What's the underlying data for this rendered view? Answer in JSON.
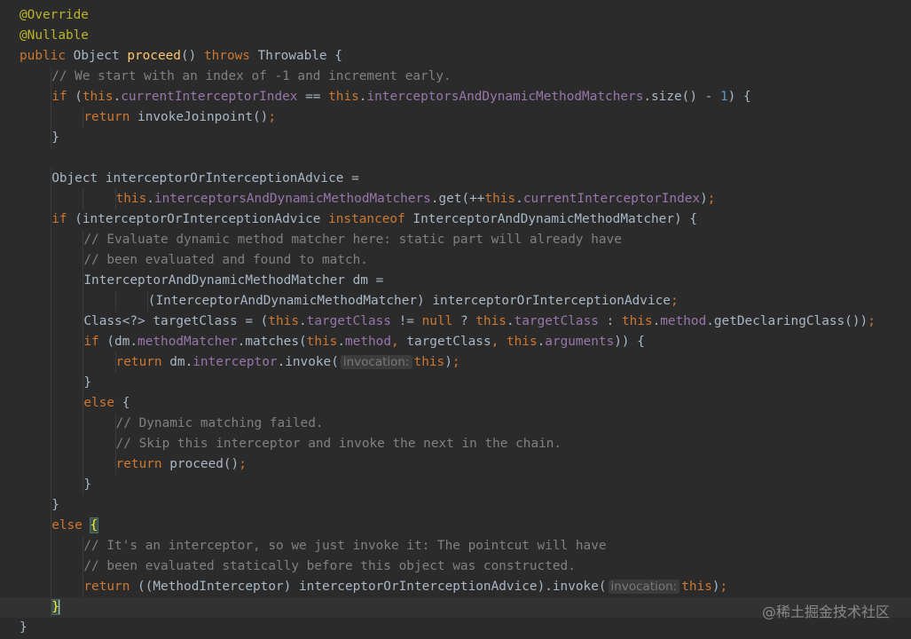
{
  "editor": {
    "theme_colors": {
      "background": "#2b2b2b",
      "keyword": "#cc7832",
      "annotation": "#bbb529",
      "comment": "#808080",
      "field": "#9876aa",
      "method_declaration": "#ffc66d",
      "number": "#6897bb",
      "plain": "#a9b7c6",
      "brace_match": "#ffef28"
    },
    "lines": [
      {
        "indent": 0,
        "tokens": [
          {
            "t": "@Override",
            "c": "ann"
          }
        ]
      },
      {
        "indent": 0,
        "tokens": [
          {
            "t": "@Nullable",
            "c": "ann"
          }
        ]
      },
      {
        "indent": 0,
        "tokens": [
          {
            "t": "public ",
            "c": "kw"
          },
          {
            "t": "Object ",
            "c": "pl"
          },
          {
            "t": "proceed",
            "c": "fn"
          },
          {
            "t": "() ",
            "c": "pl"
          },
          {
            "t": "throws ",
            "c": "kw"
          },
          {
            "t": "Throwable {",
            "c": "pl"
          }
        ]
      },
      {
        "indent": 1,
        "tokens": [
          {
            "t": "// We start with an index of -1 and increment early.",
            "c": "cm"
          }
        ]
      },
      {
        "indent": 1,
        "tokens": [
          {
            "t": "if ",
            "c": "kw"
          },
          {
            "t": "(",
            "c": "pl"
          },
          {
            "t": "this",
            "c": "kw"
          },
          {
            "t": ".",
            "c": "pl"
          },
          {
            "t": "currentInterceptorIndex",
            "c": "fld"
          },
          {
            "t": " == ",
            "c": "pl"
          },
          {
            "t": "this",
            "c": "kw"
          },
          {
            "t": ".",
            "c": "pl"
          },
          {
            "t": "interceptorsAndDynamicMethodMatchers",
            "c": "fld"
          },
          {
            "t": ".size() - ",
            "c": "pl"
          },
          {
            "t": "1",
            "c": "num"
          },
          {
            "t": ") {",
            "c": "pl"
          }
        ]
      },
      {
        "indent": 2,
        "tokens": [
          {
            "t": "return ",
            "c": "kw"
          },
          {
            "t": "invokeJoinpoint()",
            "c": "pl"
          },
          {
            "t": ";",
            "c": "kw"
          }
        ]
      },
      {
        "indent": 1,
        "tokens": [
          {
            "t": "}",
            "c": "pl"
          }
        ]
      },
      {
        "indent": 0,
        "tokens": []
      },
      {
        "indent": 1,
        "tokens": [
          {
            "t": "Object interceptorOrInterceptionAdvice =",
            "c": "pl"
          }
        ]
      },
      {
        "indent": 3,
        "tokens": [
          {
            "t": "this",
            "c": "kw"
          },
          {
            "t": ".",
            "c": "pl"
          },
          {
            "t": "interceptorsAndDynamicMethodMatchers",
            "c": "fld"
          },
          {
            "t": ".get(++",
            "c": "pl"
          },
          {
            "t": "this",
            "c": "kw"
          },
          {
            "t": ".",
            "c": "pl"
          },
          {
            "t": "currentInterceptorIndex",
            "c": "fld"
          },
          {
            "t": ")",
            "c": "pl"
          },
          {
            "t": ";",
            "c": "kw"
          }
        ]
      },
      {
        "indent": 1,
        "tokens": [
          {
            "t": "if ",
            "c": "kw"
          },
          {
            "t": "(interceptorOrInterceptionAdvice ",
            "c": "pl"
          },
          {
            "t": "instanceof ",
            "c": "kw"
          },
          {
            "t": "InterceptorAndDynamicMethodMatcher) {",
            "c": "pl"
          }
        ]
      },
      {
        "indent": 2,
        "tokens": [
          {
            "t": "// Evaluate dynamic method matcher here: static part will already have",
            "c": "cm"
          }
        ]
      },
      {
        "indent": 2,
        "tokens": [
          {
            "t": "// been evaluated and found to match.",
            "c": "cm"
          }
        ]
      },
      {
        "indent": 2,
        "tokens": [
          {
            "t": "InterceptorAndDynamicMethodMatcher dm =",
            "c": "pl"
          }
        ]
      },
      {
        "indent": 4,
        "tokens": [
          {
            "t": "(InterceptorAndDynamicMethodMatcher) interceptorOrInterceptionAdvice",
            "c": "pl"
          },
          {
            "t": ";",
            "c": "kw"
          }
        ]
      },
      {
        "indent": 2,
        "tokens": [
          {
            "t": "Class<?> targetClass = (",
            "c": "pl"
          },
          {
            "t": "this",
            "c": "kw"
          },
          {
            "t": ".",
            "c": "pl"
          },
          {
            "t": "targetClass",
            "c": "fld"
          },
          {
            "t": " != ",
            "c": "pl"
          },
          {
            "t": "null",
            "c": "kw"
          },
          {
            "t": " ? ",
            "c": "pl"
          },
          {
            "t": "this",
            "c": "kw"
          },
          {
            "t": ".",
            "c": "pl"
          },
          {
            "t": "targetClass",
            "c": "fld"
          },
          {
            "t": " : ",
            "c": "pl"
          },
          {
            "t": "this",
            "c": "kw"
          },
          {
            "t": ".",
            "c": "pl"
          },
          {
            "t": "method",
            "c": "fld"
          },
          {
            "t": ".getDeclaringClass())",
            "c": "pl"
          },
          {
            "t": ";",
            "c": "kw"
          }
        ]
      },
      {
        "indent": 2,
        "tokens": [
          {
            "t": "if ",
            "c": "kw"
          },
          {
            "t": "(dm.",
            "c": "pl"
          },
          {
            "t": "methodMatcher",
            "c": "fld"
          },
          {
            "t": ".matches(",
            "c": "pl"
          },
          {
            "t": "this",
            "c": "kw"
          },
          {
            "t": ".",
            "c": "pl"
          },
          {
            "t": "method",
            "c": "fld"
          },
          {
            "t": ", ",
            "c": "kw"
          },
          {
            "t": "targetClass",
            "c": "pl"
          },
          {
            "t": ", ",
            "c": "kw"
          },
          {
            "t": "this",
            "c": "kw"
          },
          {
            "t": ".",
            "c": "pl"
          },
          {
            "t": "arguments",
            "c": "fld"
          },
          {
            "t": ")) {",
            "c": "pl"
          }
        ]
      },
      {
        "indent": 3,
        "tokens": [
          {
            "t": "return ",
            "c": "kw"
          },
          {
            "t": "dm.",
            "c": "pl"
          },
          {
            "t": "interceptor",
            "c": "fld"
          },
          {
            "t": ".invoke(",
            "c": "pl"
          },
          {
            "t": "invocation:",
            "c": "hint"
          },
          {
            "t": "this",
            "c": "kw"
          },
          {
            "t": ")",
            "c": "pl"
          },
          {
            "t": ";",
            "c": "kw"
          }
        ]
      },
      {
        "indent": 2,
        "tokens": [
          {
            "t": "}",
            "c": "pl"
          }
        ]
      },
      {
        "indent": 2,
        "tokens": [
          {
            "t": "else ",
            "c": "kw"
          },
          {
            "t": "{",
            "c": "pl"
          }
        ]
      },
      {
        "indent": 3,
        "tokens": [
          {
            "t": "// Dynamic matching failed.",
            "c": "cm"
          }
        ]
      },
      {
        "indent": 3,
        "tokens": [
          {
            "t": "// Skip this interceptor and invoke the next in the chain.",
            "c": "cm"
          }
        ]
      },
      {
        "indent": 3,
        "tokens": [
          {
            "t": "return ",
            "c": "kw"
          },
          {
            "t": "proceed()",
            "c": "pl"
          },
          {
            "t": ";",
            "c": "kw"
          }
        ]
      },
      {
        "indent": 2,
        "tokens": [
          {
            "t": "}",
            "c": "pl"
          }
        ]
      },
      {
        "indent": 1,
        "tokens": [
          {
            "t": "}",
            "c": "pl"
          }
        ]
      },
      {
        "indent": 1,
        "tokens": [
          {
            "t": "else ",
            "c": "kw"
          },
          {
            "t": "{",
            "c": "brace-match"
          }
        ]
      },
      {
        "indent": 2,
        "tokens": [
          {
            "t": "// It's an interceptor, so we just invoke it: The pointcut will have",
            "c": "cm"
          }
        ]
      },
      {
        "indent": 2,
        "tokens": [
          {
            "t": "// been evaluated statically before this object was constructed.",
            "c": "cm"
          }
        ]
      },
      {
        "indent": 2,
        "tokens": [
          {
            "t": "return ",
            "c": "kw"
          },
          {
            "t": "((MethodInterceptor) interceptorOrInterceptionAdvice).invoke(",
            "c": "pl"
          },
          {
            "t": "invocation:",
            "c": "hint"
          },
          {
            "t": "this",
            "c": "kw"
          },
          {
            "t": ")",
            "c": "pl"
          },
          {
            "t": ";",
            "c": "kw"
          }
        ]
      },
      {
        "indent": 1,
        "current": true,
        "tokens": [
          {
            "t": "}",
            "c": "brace-match"
          },
          {
            "t": "",
            "c": "caret"
          }
        ]
      },
      {
        "indent": 0,
        "tokens": [
          {
            "t": "}",
            "c": "pl"
          }
        ]
      }
    ]
  },
  "watermark": {
    "text": "@稀土掘金技术社区"
  }
}
